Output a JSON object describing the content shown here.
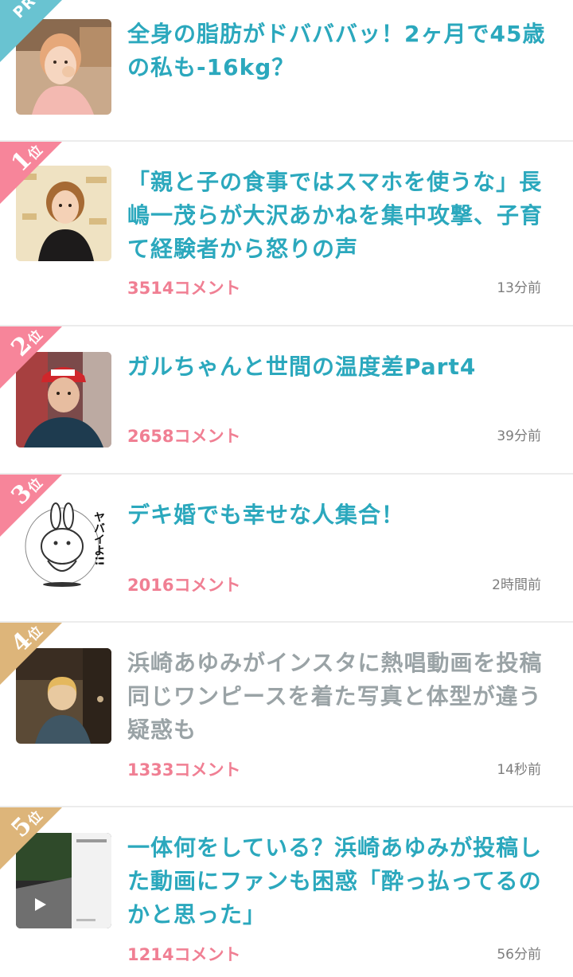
{
  "colors": {
    "pr_badge": "#69c3d1",
    "rank_badge_pink": "#f7859a",
    "rank_badge_gold": "#ddb57a",
    "title_unread": "#2ba8bd",
    "title_read": "#9aa3a6",
    "comment_count": "#f07f93",
    "timestamp": "#7d7d7d"
  },
  "pr_item": {
    "badge": "PR",
    "title": "全身の脂肪がドバババッ！2ヶ月で45歳の私も-16kg？",
    "thumbnail": "woman-eating-photo"
  },
  "topics": [
    {
      "rank": "1",
      "rank_suffix": "位",
      "title": "「親と子の食事ではスマホを使うな」長嶋一茂らが大沢あかねを集中攻撃、子育て経験者から怒りの声",
      "comments": "3514コメント",
      "time": "13分前",
      "thumbnail": "woman-at-event-photo"
    },
    {
      "rank": "2",
      "rank_suffix": "位",
      "title": "ガルちゃんと世間の温度差Part4",
      "comments": "2658コメント",
      "time": "39分前",
      "thumbnail": "man-in-cap-photo"
    },
    {
      "rank": "3",
      "rank_suffix": "位",
      "title": "デキ婚でも幸せな人集合！",
      "comments": "2016コメント",
      "time": "2時間前",
      "thumbnail": "rabbit-sticker-illustration",
      "thumbnail_text": "ヤバイよ!!"
    },
    {
      "rank": "4",
      "rank_suffix": "位",
      "title": "浜崎あゆみがインスタに熱唱動画を投稿　同じワンピースを着た写真と体型が違う疑惑も",
      "comments": "1333コメント",
      "time": "14秒前",
      "thumbnail": "singer-on-stage-photo"
    },
    {
      "rank": "5",
      "rank_suffix": "位",
      "title": "一体何をしている？浜崎あゆみが投稿した動画にファンも困惑「酔っ払ってるのかと思った」",
      "comments": "1214コメント",
      "time": "56分前",
      "thumbnail": "night-video-screenshot"
    }
  ]
}
